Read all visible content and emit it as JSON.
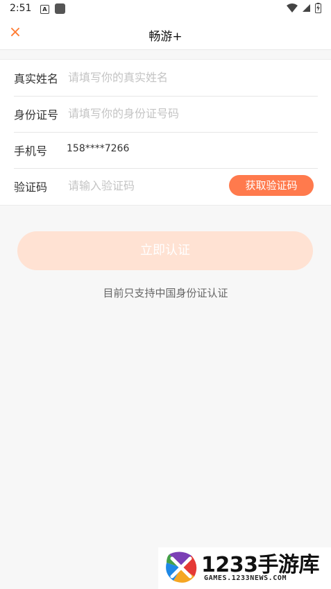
{
  "status_bar": {
    "time": "2:51",
    "notification_icon_letter": "A",
    "icons": [
      "wifi-icon",
      "signal-icon",
      "battery-charging-icon"
    ]
  },
  "header": {
    "close_icon": "×",
    "title": "畅游+"
  },
  "form": {
    "name": {
      "label": "真实姓名",
      "placeholder": "请填写你的真实姓名"
    },
    "id_number": {
      "label": "身份证号",
      "placeholder": "请填写你的身份证号码"
    },
    "phone": {
      "label": "手机号",
      "value": "158****7266"
    },
    "code": {
      "label": "验证码",
      "placeholder": "请输入验证码",
      "button": "获取验证码"
    }
  },
  "submit_label": "立即认证",
  "hint": "目前只支持中国身份证认证",
  "watermark": {
    "title": "1233手游库",
    "subtitle": "GAMES.1233NEWS.COM"
  },
  "colors": {
    "accent": "#ff7a30",
    "button": "#ff7a4d",
    "submit_disabled": "#ffe2d3"
  }
}
